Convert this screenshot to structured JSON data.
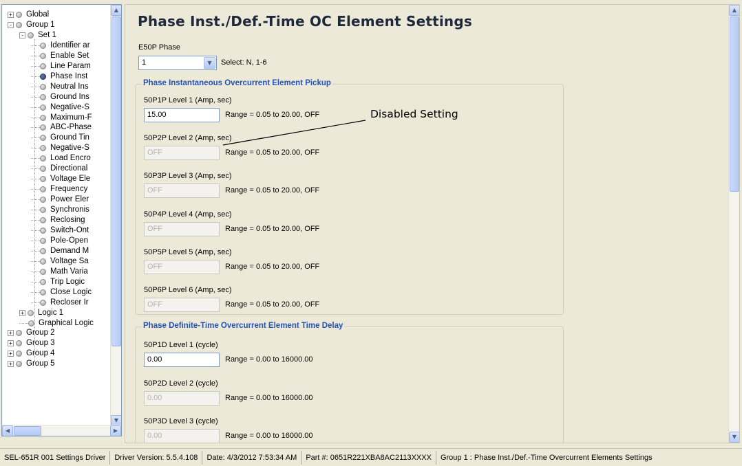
{
  "tree": {
    "items": [
      {
        "label": "Global",
        "expander": "+",
        "dot": "normal"
      },
      {
        "label": "Group 1",
        "expander": "-",
        "dot": "normal"
      },
      {
        "label": "Set 1",
        "expander": "-",
        "dot": "normal"
      },
      {
        "label": "Identifier ar",
        "expander": "",
        "dot": "normal"
      },
      {
        "label": "Enable Set",
        "expander": "",
        "dot": "normal"
      },
      {
        "label": "Line Param",
        "expander": "",
        "dot": "normal"
      },
      {
        "label": "Phase Inst",
        "expander": "",
        "dot": "selected"
      },
      {
        "label": "Neutral Ins",
        "expander": "",
        "dot": "normal"
      },
      {
        "label": "Ground Ins",
        "expander": "",
        "dot": "normal"
      },
      {
        "label": "Negative-S",
        "expander": "",
        "dot": "normal"
      },
      {
        "label": "Maximum-F",
        "expander": "",
        "dot": "normal"
      },
      {
        "label": "ABC-Phase",
        "expander": "",
        "dot": "normal"
      },
      {
        "label": "Ground Tin",
        "expander": "",
        "dot": "normal"
      },
      {
        "label": "Negative-S",
        "expander": "",
        "dot": "normal"
      },
      {
        "label": "Load Encro",
        "expander": "",
        "dot": "normal"
      },
      {
        "label": "Directional",
        "expander": "",
        "dot": "normal"
      },
      {
        "label": "Voltage Ele",
        "expander": "",
        "dot": "normal"
      },
      {
        "label": "Frequency",
        "expander": "",
        "dot": "normal"
      },
      {
        "label": "Power Eler",
        "expander": "",
        "dot": "normal"
      },
      {
        "label": "Synchronis",
        "expander": "",
        "dot": "normal"
      },
      {
        "label": "Reclosing",
        "expander": "",
        "dot": "normal"
      },
      {
        "label": "Switch-Ont",
        "expander": "",
        "dot": "normal"
      },
      {
        "label": "Pole-Open",
        "expander": "",
        "dot": "normal"
      },
      {
        "label": "Demand M",
        "expander": "",
        "dot": "normal"
      },
      {
        "label": "Voltage Sa",
        "expander": "",
        "dot": "normal"
      },
      {
        "label": "Math Varia",
        "expander": "",
        "dot": "normal"
      },
      {
        "label": "Trip Logic",
        "expander": "",
        "dot": "normal"
      },
      {
        "label": "Close Logic",
        "expander": "",
        "dot": "normal"
      },
      {
        "label": "Recloser Ir",
        "expander": "",
        "dot": "normal"
      },
      {
        "label": "Logic 1",
        "expander": "+",
        "dot": "normal"
      },
      {
        "label": "Graphical Logic",
        "expander": "",
        "dot": "normal"
      },
      {
        "label": "Group 2",
        "expander": "+",
        "dot": "normal"
      },
      {
        "label": "Group 3",
        "expander": "+",
        "dot": "normal"
      },
      {
        "label": "Group 4",
        "expander": "+",
        "dot": "normal"
      },
      {
        "label": "Group 5",
        "expander": "+",
        "dot": "normal"
      }
    ]
  },
  "main": {
    "title": "Phase Inst./Def.-Time OC Element Settings",
    "e50p": {
      "label": "E50P  Phase",
      "value": "1",
      "hint": "Select: N, 1-6"
    },
    "pickup_group": {
      "title": "Phase Instantaneous Overcurrent Element Pickup",
      "fields": [
        {
          "label": "50P1P  Level 1 (Amp, sec)",
          "value": "15.00",
          "range": "Range = 0.05 to 20.00, OFF",
          "disabled": false
        },
        {
          "label": "50P2P  Level 2 (Amp, sec)",
          "value": "OFF",
          "range": "Range = 0.05 to 20.00, OFF",
          "disabled": true
        },
        {
          "label": "50P3P  Level 3 (Amp, sec)",
          "value": "OFF",
          "range": "Range = 0.05 to 20.00, OFF",
          "disabled": true
        },
        {
          "label": "50P4P  Level 4 (Amp, sec)",
          "value": "OFF",
          "range": "Range = 0.05 to 20.00, OFF",
          "disabled": true
        },
        {
          "label": "50P5P  Level 5 (Amp, sec)",
          "value": "OFF",
          "range": "Range = 0.05 to 20.00, OFF",
          "disabled": true
        },
        {
          "label": "50P6P  Level 6 (Amp, sec)",
          "value": "OFF",
          "range": "Range = 0.05 to 20.00, OFF",
          "disabled": true
        }
      ]
    },
    "delay_group": {
      "title": "Phase Definite-Time Overcurrent Element Time Delay",
      "fields": [
        {
          "label": "50P1D  Level 1 (cycle)",
          "value": "0.00",
          "range": "Range = 0.00 to 16000.00",
          "disabled": false
        },
        {
          "label": "50P2D  Level 2 (cycle)",
          "value": "0.00",
          "range": "Range = 0.00 to 16000.00",
          "disabled": true
        },
        {
          "label": "50P3D  Level 3 (cycle)",
          "value": "0.00",
          "range": "Range = 0.00 to 16000.00",
          "disabled": true
        }
      ]
    },
    "callout": "Disabled Setting"
  },
  "status_bar": {
    "driver": "SEL-651R 001 Settings Driver",
    "version": "Driver Version: 5.5.4.108",
    "date": "Date: 4/3/2012 7:53:34 AM",
    "part": "Part #: 0651R221XBA8AC2113XXXX",
    "context": "Group 1 : Phase Inst./Def.-Time Overcurrent Elements Settings"
  },
  "colors": {
    "group_title": "#2452b5",
    "window_bg": "#ece9d8",
    "selected_dot": "#233a6b"
  }
}
